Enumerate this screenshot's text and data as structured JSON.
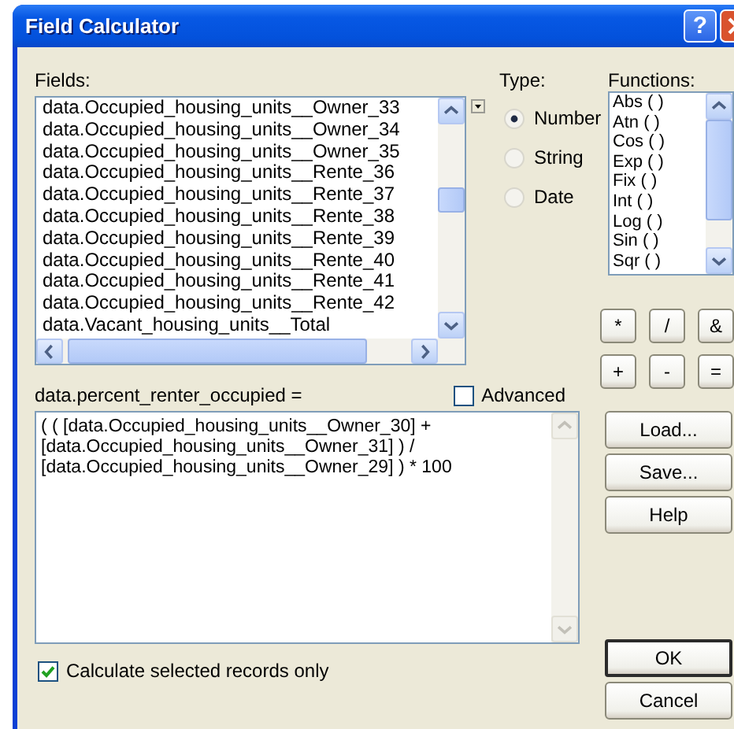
{
  "window": {
    "title": "Field Calculator",
    "help_button": "?"
  },
  "fields": {
    "label": "Fields:",
    "items": [
      "data.Occupied_housing_units__Owner_33",
      "data.Occupied_housing_units__Owner_34",
      "data.Occupied_housing_units__Owner_35",
      "data.Occupied_housing_units__Rente_36",
      "data.Occupied_housing_units__Rente_37",
      "data.Occupied_housing_units__Rente_38",
      "data.Occupied_housing_units__Rente_39",
      "data.Occupied_housing_units__Rente_40",
      "data.Occupied_housing_units__Rente_41",
      "data.Occupied_housing_units__Rente_42",
      "data.Vacant_housing_units__Total"
    ]
  },
  "type": {
    "label": "Type:",
    "options": [
      {
        "label": "Number",
        "selected": true
      },
      {
        "label": "String",
        "selected": false
      },
      {
        "label": "Date",
        "selected": false
      }
    ]
  },
  "functions": {
    "label": "Functions:",
    "items": [
      "Abs ( )",
      "Atn ( )",
      "Cos ( )",
      "Exp ( )",
      "Fix ( )",
      "Int ( )",
      "Log ( )",
      "Sin ( )",
      "Sqr ( )"
    ]
  },
  "operators": [
    "*",
    "/",
    "&",
    "+",
    "-",
    "="
  ],
  "expression": {
    "label": "data.percent_renter_occupied =",
    "advanced": {
      "label": "Advanced",
      "checked": false
    },
    "value": "( ( [data.Occupied_housing_units__Owner_30] +\n[data.Occupied_housing_units__Owner_31] ) /\n[data.Occupied_housing_units__Owner_29] ) * 100"
  },
  "buttons": [
    {
      "label": "Load...",
      "default": false
    },
    {
      "label": "Save...",
      "default": false
    },
    {
      "label": "Help",
      "default": false
    },
    {
      "label": "OK",
      "default": true
    },
    {
      "label": "Cancel",
      "default": false
    }
  ],
  "calculate_selected": {
    "label": "Calculate selected records only",
    "checked": true
  }
}
